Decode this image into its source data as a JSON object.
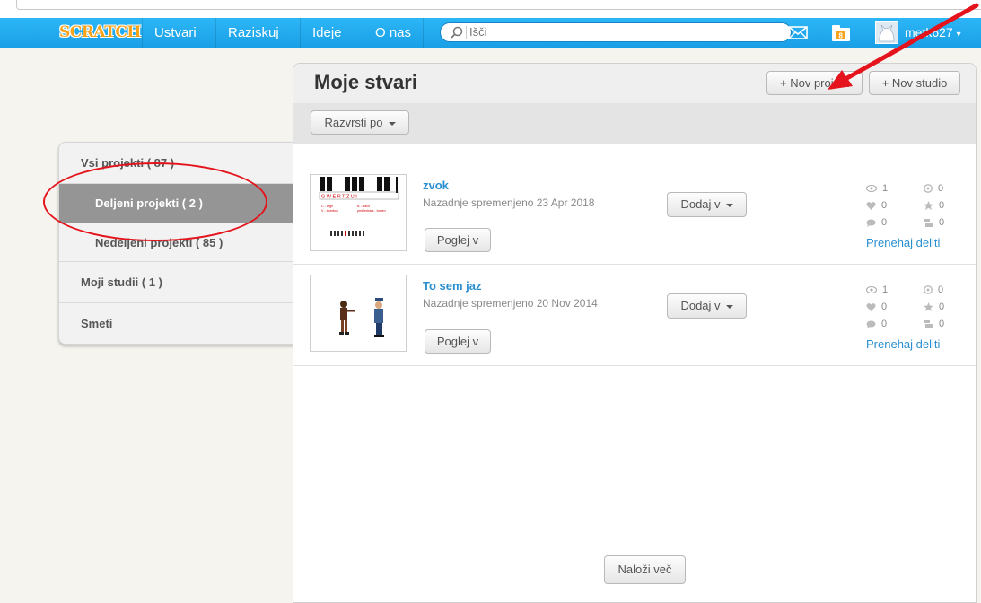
{
  "nav": {
    "logo": "SCRATCH",
    "links": [
      "Ustvari",
      "Raziskuj",
      "Ideje",
      "O nas"
    ],
    "search_placeholder": "Išči",
    "username": "metk627"
  },
  "colors": {
    "nav_bg": "#25aff4",
    "link_blue": "#2a8fd1",
    "annotation_red": "#e5131b",
    "sidebar_active": "#959595"
  },
  "sidebar": {
    "items": [
      {
        "label": "Vsi projekti ( 87 )"
      },
      {
        "label": "Deljeni projekti ( 2 )"
      },
      {
        "label": "Nedeljeni projekti ( 85 )"
      },
      {
        "label": "Moji studii ( 1 )"
      },
      {
        "label": "Smeti"
      }
    ]
  },
  "main": {
    "title": "Moje stvari",
    "new_project": "+ Nov projekt",
    "new_studio": "+ Nov studio",
    "sort_label": "Razvrsti po",
    "load_more": "Naloži več"
  },
  "projects": [
    {
      "title": "zvok",
      "date": "Nazadnje spremenjeno 23 Apr 2018",
      "add_to": "Dodaj v",
      "view": "Poglej v",
      "views": "1",
      "loves": "0",
      "comments": "0",
      "remixes": "0",
      "favorites": "0",
      "studios": "0",
      "unshare": "Prenehaj deliti",
      "thumb_text": {
        "keys": "G W E R T Z U I",
        "left1": "C - orgn",
        "left2": "V - trombon",
        "right1": "B - klavir",
        "right2": "preklednica - boben"
      }
    },
    {
      "title": "To sem jaz",
      "date": "Nazadnje spremenjeno 20 Nov 2014",
      "add_to": "Dodaj v",
      "view": "Poglej v",
      "views": "1",
      "loves": "0",
      "comments": "0",
      "remixes": "0",
      "favorites": "0",
      "studios": "0",
      "unshare": "Prenehaj deliti"
    }
  ]
}
